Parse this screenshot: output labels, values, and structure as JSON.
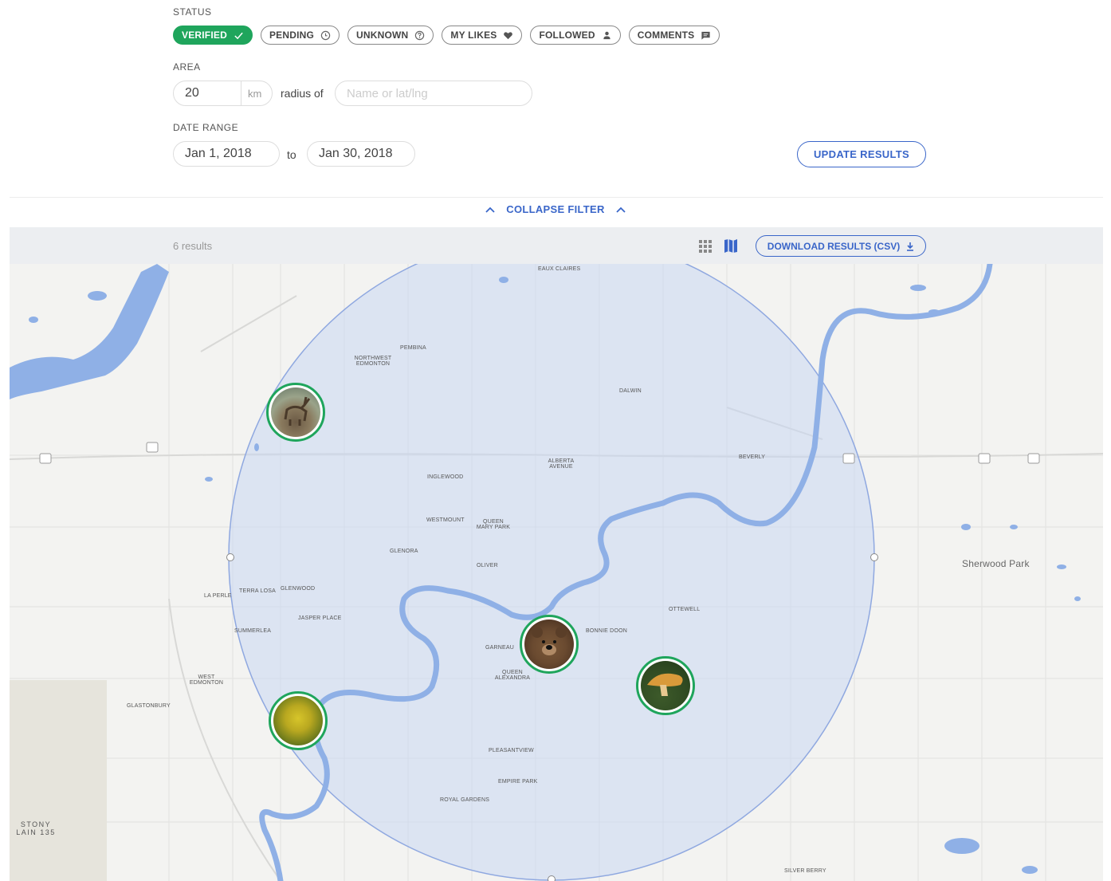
{
  "filters": {
    "status_label": "STATUS",
    "chips": [
      {
        "label": "VERIFIED",
        "icon": "check-icon",
        "active": true
      },
      {
        "label": "PENDING",
        "icon": "clock-icon",
        "active": false
      },
      {
        "label": "UNKNOWN",
        "icon": "question-icon",
        "active": false
      },
      {
        "label": "MY LIKES",
        "icon": "heart-icon",
        "active": false
      },
      {
        "label": "FOLLOWED",
        "icon": "person-icon",
        "active": false
      },
      {
        "label": "COMMENTS",
        "icon": "comment-icon",
        "active": false
      }
    ],
    "area_label": "AREA",
    "radius_value": "20",
    "radius_unit": "km",
    "radius_of_text": "radius of",
    "location_placeholder": "Name or lat/lng",
    "date_range_label": "DATE RANGE",
    "date_from": "Jan 1, 2018",
    "date_to_text": "to",
    "date_to": "Jan 30, 2018",
    "update_button": "UPDATE RESULTS",
    "collapse_label": "COLLAPSE FILTER"
  },
  "results": {
    "count_text": "6 results",
    "download_button": "DOWNLOAD RESULTS (CSV)",
    "view_icons": [
      "grid-view-icon",
      "map-view-icon"
    ]
  },
  "map": {
    "labels": {
      "sherwood_park": "Sherwood Park",
      "stony_plain": "STONY LAIN 135",
      "eaux_claires": "EAUX CLAIRES",
      "pembina": "PEMBINA",
      "northwest_edmonton": "NORTHWEST EDMONTON",
      "dalwin": "DALWIN",
      "alberta_avenue": "ALBERTA AVENUE",
      "beverly": "BEVERLY",
      "inglewood": "INGLEWOOD",
      "westmount": "WESTMOUNT",
      "queen_mary_park": "QUEEN MARY PARK",
      "glenora": "GLENORA",
      "oliver": "OLIVER",
      "la_perle": "LA PERLE",
      "terra_losa": "TERRA LOSA",
      "glenwood": "GLENWOOD",
      "jasper_place": "JASPER PLACE",
      "summerlea": "SUMMERLEA",
      "west_edmonton": "WEST EDMONTON",
      "glastonbury": "GLASTONBURY",
      "bonnie_doon": "BONNIE DOON",
      "ottewell": "OTTEWELL",
      "garneau": "GARNEAU",
      "queen_alexandra": "QUEEN ALEXANDRA",
      "pleasantview": "PLEASANTVIEW",
      "empire_park": "EMPIRE PARK",
      "royal_gardens": "ROYAL GARDENS",
      "silver_berry": "SILVER BERRY"
    },
    "markers": [
      {
        "name": "elk-observation-marker",
        "subject": "elk"
      },
      {
        "name": "bear-observation-marker",
        "subject": "bear"
      },
      {
        "name": "plant-observation-marker",
        "subject": "yellow flowers"
      },
      {
        "name": "mushroom-observation-marker",
        "subject": "mushroom"
      }
    ],
    "colors": {
      "accent": "#3a66c9",
      "verified": "#1fa55c",
      "water": "#8fb0e6",
      "radius_fill": "#c9d7f3"
    }
  }
}
